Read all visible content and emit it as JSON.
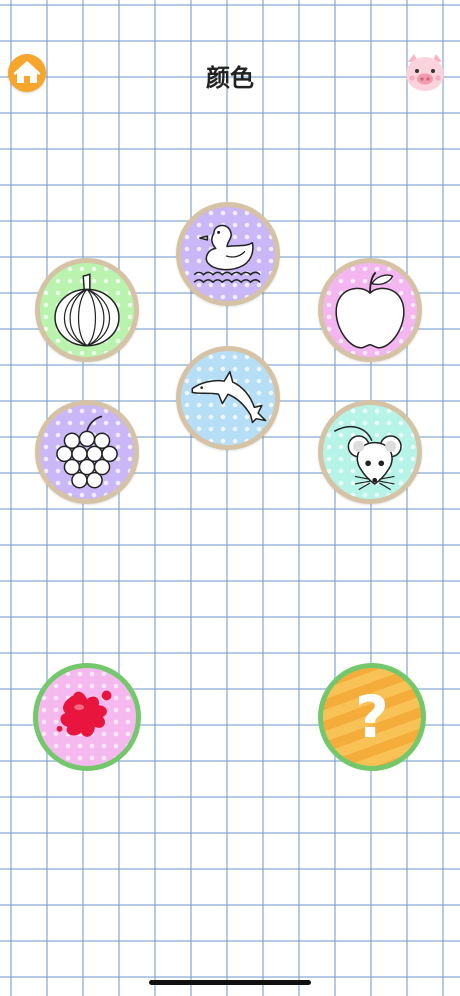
{
  "header": {
    "title": "颜色",
    "home_icon": "home-icon",
    "profile_icon": "pig-face-icon"
  },
  "drawings": [
    {
      "name": "duck",
      "icon": "duck-outline-icon",
      "background": "#c9b7f7"
    },
    {
      "name": "pumpkin",
      "icon": "pumpkin-outline-icon",
      "background": "#b9f3ae"
    },
    {
      "name": "apple",
      "icon": "apple-outline-icon",
      "background": "#f3b6f1"
    },
    {
      "name": "dolphin",
      "icon": "dolphin-outline-icon",
      "background": "#b7def7"
    },
    {
      "name": "grapes",
      "icon": "grapes-outline-icon",
      "background": "#c9b7f7"
    },
    {
      "name": "mouse",
      "icon": "mouse-outline-icon",
      "background": "#b6f4e8"
    }
  ],
  "actions": {
    "paint_icon": "paint-splash-icon",
    "help_label": "?"
  },
  "colors": {
    "accent_orange": "#f6a62b",
    "ring_green": "#72c86a",
    "ring_tan": "#d6c3a6",
    "grid_blue": "#78a0cd"
  }
}
